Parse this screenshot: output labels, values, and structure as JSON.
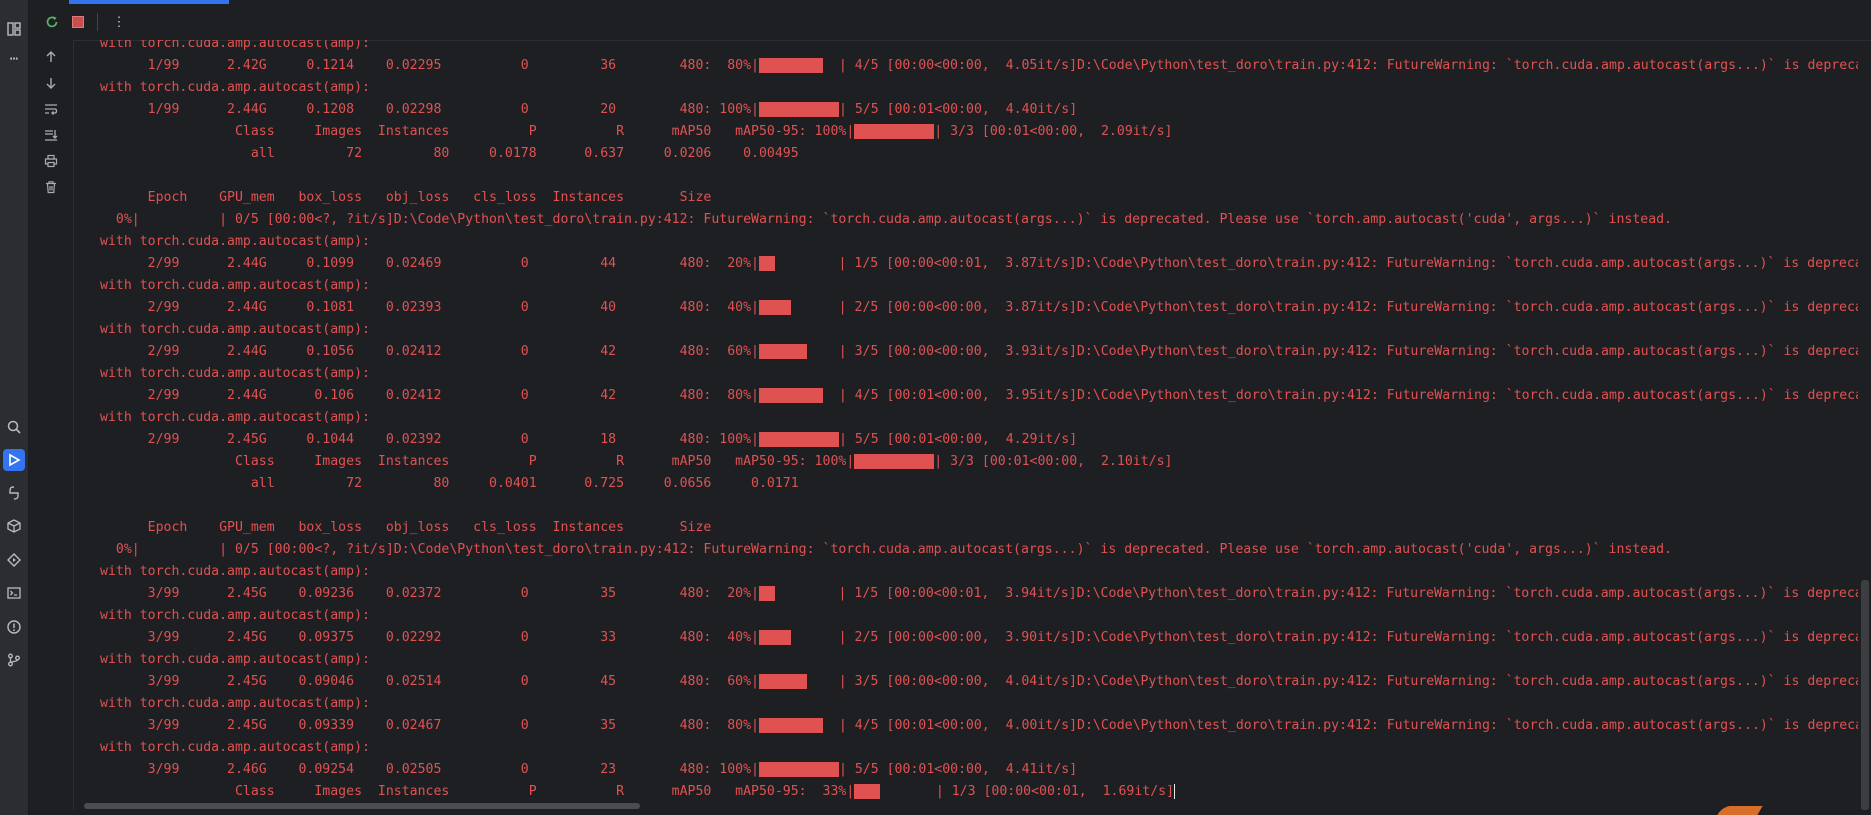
{
  "left_toolbar": {
    "icons": [
      "structure-icon",
      "more-icon",
      "search-icon",
      "run-icon",
      "python-console-icon",
      "python-packages-icon",
      "services-icon",
      "terminal-icon",
      "problems-icon",
      "git-icon"
    ]
  },
  "run_toolbar": {
    "rerun_icon": "rerun-icon",
    "stop_icon": "stop-icon",
    "more_icon": "more-options-icon"
  },
  "console_gutter": {
    "icons": [
      "scroll-up-icon",
      "scroll-down-icon",
      "soft-wrap-icon",
      "scroll-to-end-icon",
      "print-icon",
      "clear-all-icon"
    ]
  },
  "console": {
    "text_color": "#e05252",
    "lines": [
      {
        "text": "with torch.cuda.amp.autocast(amp):"
      },
      {
        "text": "      1/99      2.42G     0.1214    0.02295          0         36        480:  80%|",
        "progress": 0.8,
        "after": "  | 4/5 [00:00<00:00,  4.05it/s]D:\\Code\\Python\\test_doro\\train.py:412: FutureWarning: `torch.cuda.amp.autocast(args...)` is deprecated"
      },
      {
        "text": "with torch.cuda.amp.autocast(amp):"
      },
      {
        "text": "      1/99      2.44G     0.1208    0.02298          0         20        480: 100%|",
        "progress": 1.0,
        "after": "| 5/5 [00:01<00:00,  4.40it/s]"
      },
      {
        "text": "                 Class     Images  Instances          P          R      mAP50   mAP50-95: 100%|",
        "progress": 1.0,
        "after": "| 3/3 [00:01<00:00,  2.09it/s]"
      },
      {
        "text": "                   all         72         80     0.0178      0.637     0.0206    0.00495"
      },
      {
        "text": ""
      },
      {
        "text": "      Epoch    GPU_mem   box_loss   obj_loss   cls_loss  Instances       Size"
      },
      {
        "text": "  0%|          | 0/5 [00:00<?, ?it/s]D:\\Code\\Python\\test_doro\\train.py:412: FutureWarning: `torch.cuda.amp.autocast(args...)` is deprecated. Please use `torch.amp.autocast('cuda', args...)` instead."
      },
      {
        "text": "with torch.cuda.amp.autocast(amp):"
      },
      {
        "text": "      2/99      2.44G     0.1099    0.02469          0         44        480:  20%|",
        "progress": 0.2,
        "after": "        | 1/5 [00:00<00:01,  3.87it/s]D:\\Code\\Python\\test_doro\\train.py:412: FutureWarning: `torch.cuda.amp.autocast(args...)` is deprecated"
      },
      {
        "text": "with torch.cuda.amp.autocast(amp):"
      },
      {
        "text": "      2/99      2.44G     0.1081    0.02393          0         40        480:  40%|",
        "progress": 0.4,
        "after": "      | 2/5 [00:00<00:00,  3.87it/s]D:\\Code\\Python\\test_doro\\train.py:412: FutureWarning: `torch.cuda.amp.autocast(args...)` is deprecated"
      },
      {
        "text": "with torch.cuda.amp.autocast(amp):"
      },
      {
        "text": "      2/99      2.44G     0.1056    0.02412          0         42        480:  60%|",
        "progress": 0.6,
        "after": "    | 3/5 [00:00<00:00,  3.93it/s]D:\\Code\\Python\\test_doro\\train.py:412: FutureWarning: `torch.cuda.amp.autocast(args...)` is deprecated"
      },
      {
        "text": "with torch.cuda.amp.autocast(amp):"
      },
      {
        "text": "      2/99      2.44G      0.106    0.02412          0         42        480:  80%|",
        "progress": 0.8,
        "after": "  | 4/5 [00:01<00:00,  3.95it/s]D:\\Code\\Python\\test_doro\\train.py:412: FutureWarning: `torch.cuda.amp.autocast(args...)` is deprecated"
      },
      {
        "text": "with torch.cuda.amp.autocast(amp):"
      },
      {
        "text": "      2/99      2.45G     0.1044    0.02392          0         18        480: 100%|",
        "progress": 1.0,
        "after": "| 5/5 [00:01<00:00,  4.29it/s]"
      },
      {
        "text": "                 Class     Images  Instances          P          R      mAP50   mAP50-95: 100%|",
        "progress": 1.0,
        "after": "| 3/3 [00:01<00:00,  2.10it/s]"
      },
      {
        "text": "                   all         72         80     0.0401      0.725     0.0656     0.0171"
      },
      {
        "text": ""
      },
      {
        "text": "      Epoch    GPU_mem   box_loss   obj_loss   cls_loss  Instances       Size"
      },
      {
        "text": "  0%|          | 0/5 [00:00<?, ?it/s]D:\\Code\\Python\\test_doro\\train.py:412: FutureWarning: `torch.cuda.amp.autocast(args...)` is deprecated. Please use `torch.amp.autocast('cuda', args...)` instead."
      },
      {
        "text": "with torch.cuda.amp.autocast(amp):"
      },
      {
        "text": "      3/99      2.45G    0.09236    0.02372          0         35        480:  20%|",
        "progress": 0.2,
        "after": "        | 1/5 [00:00<00:01,  3.94it/s]D:\\Code\\Python\\test_doro\\train.py:412: FutureWarning: `torch.cuda.amp.autocast(args...)` is deprecated"
      },
      {
        "text": "with torch.cuda.amp.autocast(amp):"
      },
      {
        "text": "      3/99      2.45G    0.09375    0.02292          0         33        480:  40%|",
        "progress": 0.4,
        "after": "      | 2/5 [00:00<00:00,  3.90it/s]D:\\Code\\Python\\test_doro\\train.py:412: FutureWarning: `torch.cuda.amp.autocast(args...)` is deprecated"
      },
      {
        "text": "with torch.cuda.amp.autocast(amp):"
      },
      {
        "text": "      3/99      2.45G    0.09046    0.02514          0         45        480:  60%|",
        "progress": 0.6,
        "after": "    | 3/5 [00:00<00:00,  4.04it/s]D:\\Code\\Python\\test_doro\\train.py:412: FutureWarning: `torch.cuda.amp.autocast(args...)` is deprecated"
      },
      {
        "text": "with torch.cuda.amp.autocast(amp):"
      },
      {
        "text": "      3/99      2.45G    0.09339    0.02467          0         35        480:  80%|",
        "progress": 0.8,
        "after": "  | 4/5 [00:01<00:00,  4.00it/s]D:\\Code\\Python\\test_doro\\train.py:412: FutureWarning: `torch.cuda.amp.autocast(args...)` is deprecated"
      },
      {
        "text": "with torch.cuda.amp.autocast(amp):"
      },
      {
        "text": "      3/99      2.46G    0.09254    0.02505          0         23        480: 100%|",
        "progress": 1.0,
        "after": "| 5/5 [00:01<00:00,  4.41it/s]"
      },
      {
        "text": "                 Class     Images  Instances          P          R      mAP50   mAP50-95:  33%|",
        "progress": 0.33,
        "after": "       | 1/3 [00:00<00:01,  1.69it/s]",
        "cursor": true
      }
    ]
  }
}
